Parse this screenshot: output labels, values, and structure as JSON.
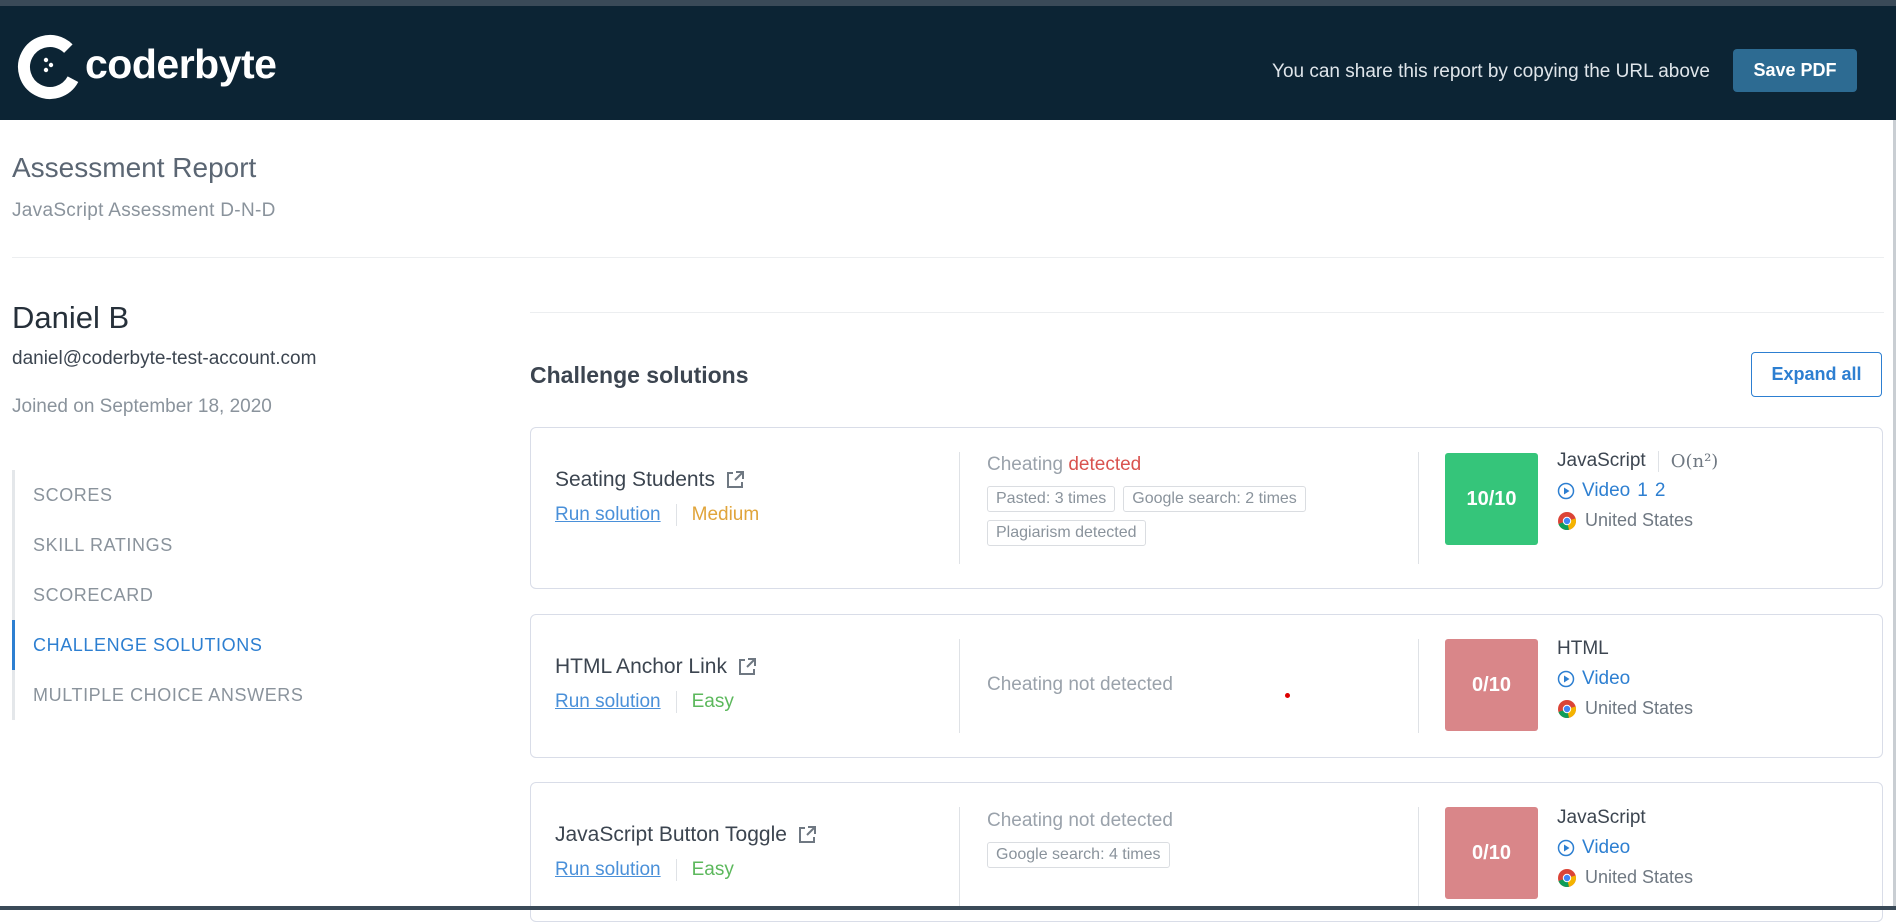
{
  "header": {
    "brand": "coderbyte",
    "share_text": "You can share this report by copying the URL above",
    "save_label": "Save PDF"
  },
  "report": {
    "title": "Assessment Report",
    "subtitle": "JavaScript Assessment D-N-D"
  },
  "candidate": {
    "name": "Daniel B",
    "email": "daniel@coderbyte-test-account.com",
    "joined": "Joined on September 18, 2020"
  },
  "nav": {
    "items": [
      {
        "label": "SCORES",
        "active": false
      },
      {
        "label": "SKILL RATINGS",
        "active": false
      },
      {
        "label": "SCORECARD",
        "active": false
      },
      {
        "label": "CHALLENGE SOLUTIONS",
        "active": true
      },
      {
        "label": "MULTIPLE CHOICE ANSWERS",
        "active": false
      }
    ]
  },
  "challenges": {
    "title": "Challenge solutions",
    "expand_label": "Expand all",
    "run_label": "Run solution",
    "items": [
      {
        "name": "Seating Students",
        "difficulty": "Medium",
        "cheating_prefix": "Cheating",
        "cheating_status": "detected",
        "tags": [
          "Pasted: 3 times",
          "Google search: 2 times",
          "Plagiarism detected"
        ],
        "score": "10/10",
        "language": "JavaScript",
        "complexity": "O(n²)",
        "video_label": "Video",
        "video_numbers": [
          "1",
          "2"
        ],
        "country": "United States"
      },
      {
        "name": "HTML Anchor Link",
        "difficulty": "Easy",
        "cheating_prefix": "Cheating not detected",
        "cheating_status": "",
        "tags": [],
        "score": "0/10",
        "language": "HTML",
        "complexity": "",
        "video_label": "Video",
        "video_numbers": [],
        "country": "United States"
      },
      {
        "name": "JavaScript Button Toggle",
        "difficulty": "Easy",
        "cheating_prefix": "Cheating not detected",
        "cheating_status": "",
        "tags": [
          "Google search: 4 times"
        ],
        "score": "0/10",
        "language": "JavaScript",
        "complexity": "",
        "video_label": "Video",
        "video_numbers": [],
        "country": "United States"
      }
    ]
  },
  "colors": {
    "header_bg": "#0c2434",
    "accent": "#2d7fd1",
    "score_pass": "#35c57a",
    "score_fail": "#d98689",
    "cheating_detected": "#d9534f"
  }
}
